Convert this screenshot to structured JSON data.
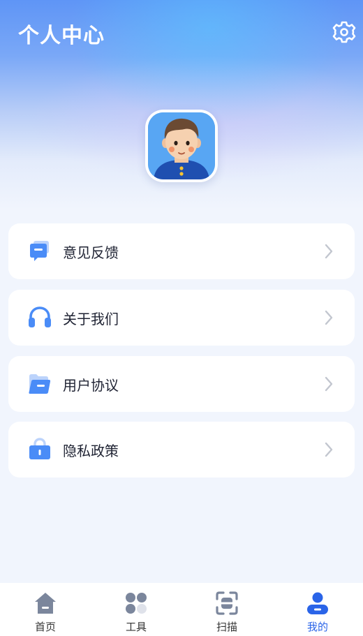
{
  "header": {
    "title": "个人中心"
  },
  "menu": [
    {
      "label": "意见反馈",
      "icon": "chat-feedback-icon"
    },
    {
      "label": "关于我们",
      "icon": "headphones-icon"
    },
    {
      "label": "用户协议",
      "icon": "folder-icon"
    },
    {
      "label": "隐私政策",
      "icon": "lock-icon"
    }
  ],
  "tabbar": {
    "items": [
      {
        "label": "首页",
        "icon": "home-icon",
        "active": false
      },
      {
        "label": "工具",
        "icon": "grid-icon",
        "active": false
      },
      {
        "label": "扫描",
        "icon": "scan-icon",
        "active": false
      },
      {
        "label": "我的",
        "icon": "user-icon",
        "active": true
      }
    ]
  },
  "colors": {
    "accent": "#2a64e8",
    "icon_blue": "#4a8cf7",
    "tab_inactive": "#7b869c",
    "chevron": "#c2c6cf"
  }
}
